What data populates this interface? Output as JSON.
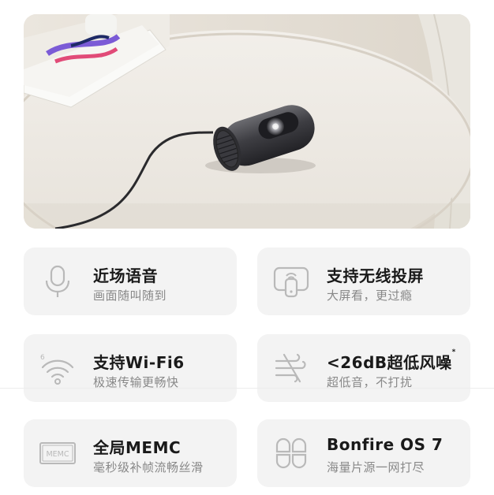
{
  "features": [
    {
      "title": "近场语音",
      "subtitle": "画面随叫随到",
      "icon": "microphone-icon"
    },
    {
      "title": "支持无线投屏",
      "subtitle": "大屏看，更过瘾",
      "icon": "wireless-cast-icon"
    },
    {
      "title": "支持Wi-Fi6",
      "subtitle": "极速传输更畅快",
      "icon": "wifi6-icon"
    },
    {
      "title": "<26dB超低风噪",
      "title_mark": "*",
      "subtitle": "超低音，不打扰",
      "icon": "wind-noise-icon"
    },
    {
      "title": "全局MEMC",
      "subtitle": "毫秒级补帧流畅丝滑",
      "icon": "memc-icon",
      "icon_text": "MEMC"
    },
    {
      "title": "Bonfire OS 7",
      "subtitle": "海量片源一网打尽",
      "icon": "bonfire-os-icon"
    }
  ],
  "colors": {
    "card_bg": "#f3f3f3",
    "title": "#1a1a1a",
    "subtitle": "#888888",
    "icon": "#b9b9b9"
  }
}
